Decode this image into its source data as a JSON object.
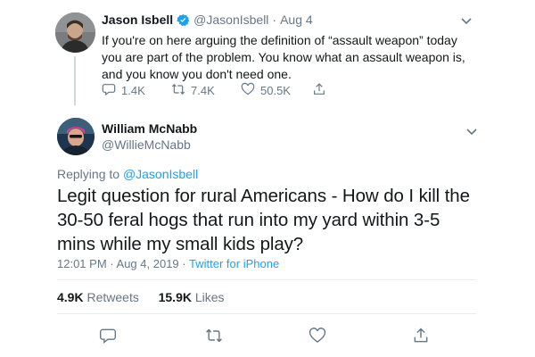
{
  "parent_tweet": {
    "display_name": "Jason Isbell",
    "handle": "@JasonIsbell",
    "separator": "·",
    "date": "Aug 4",
    "text": "If you're on here arguing the definition of “assault weapon” today you are part of the problem. You know what an assault weapon is, and you know you don't need one.",
    "replies": "1.4K",
    "retweets": "7.4K",
    "likes": "50.5K",
    "icons": [
      "verified-badge-icon",
      "reply-icon",
      "retweet-icon",
      "like-icon",
      "share-icon",
      "chevron-down-icon"
    ]
  },
  "main_tweet": {
    "display_name": "William McNabb",
    "handle": "@WillieMcNabb",
    "replying_prefix": "Replying to",
    "replying_to": "@JasonIsbell",
    "text": "Legit question for rural Americans - How do I kill the 30-50 feral hogs that run into my yard within 3-5 mins while my small kids play?",
    "time": "12:01 PM",
    "date": "Aug 4, 2019",
    "separator": "·",
    "source": "Twitter for iPhone",
    "retweets_count": "4.9K",
    "retweets_label": "Retweets",
    "likes_count": "15.9K",
    "likes_label": "Likes"
  },
  "colors": {
    "link": "#1da1f2",
    "secondary_text": "#657786",
    "primary_text": "#14171a",
    "divider": "#e6ecf0"
  }
}
